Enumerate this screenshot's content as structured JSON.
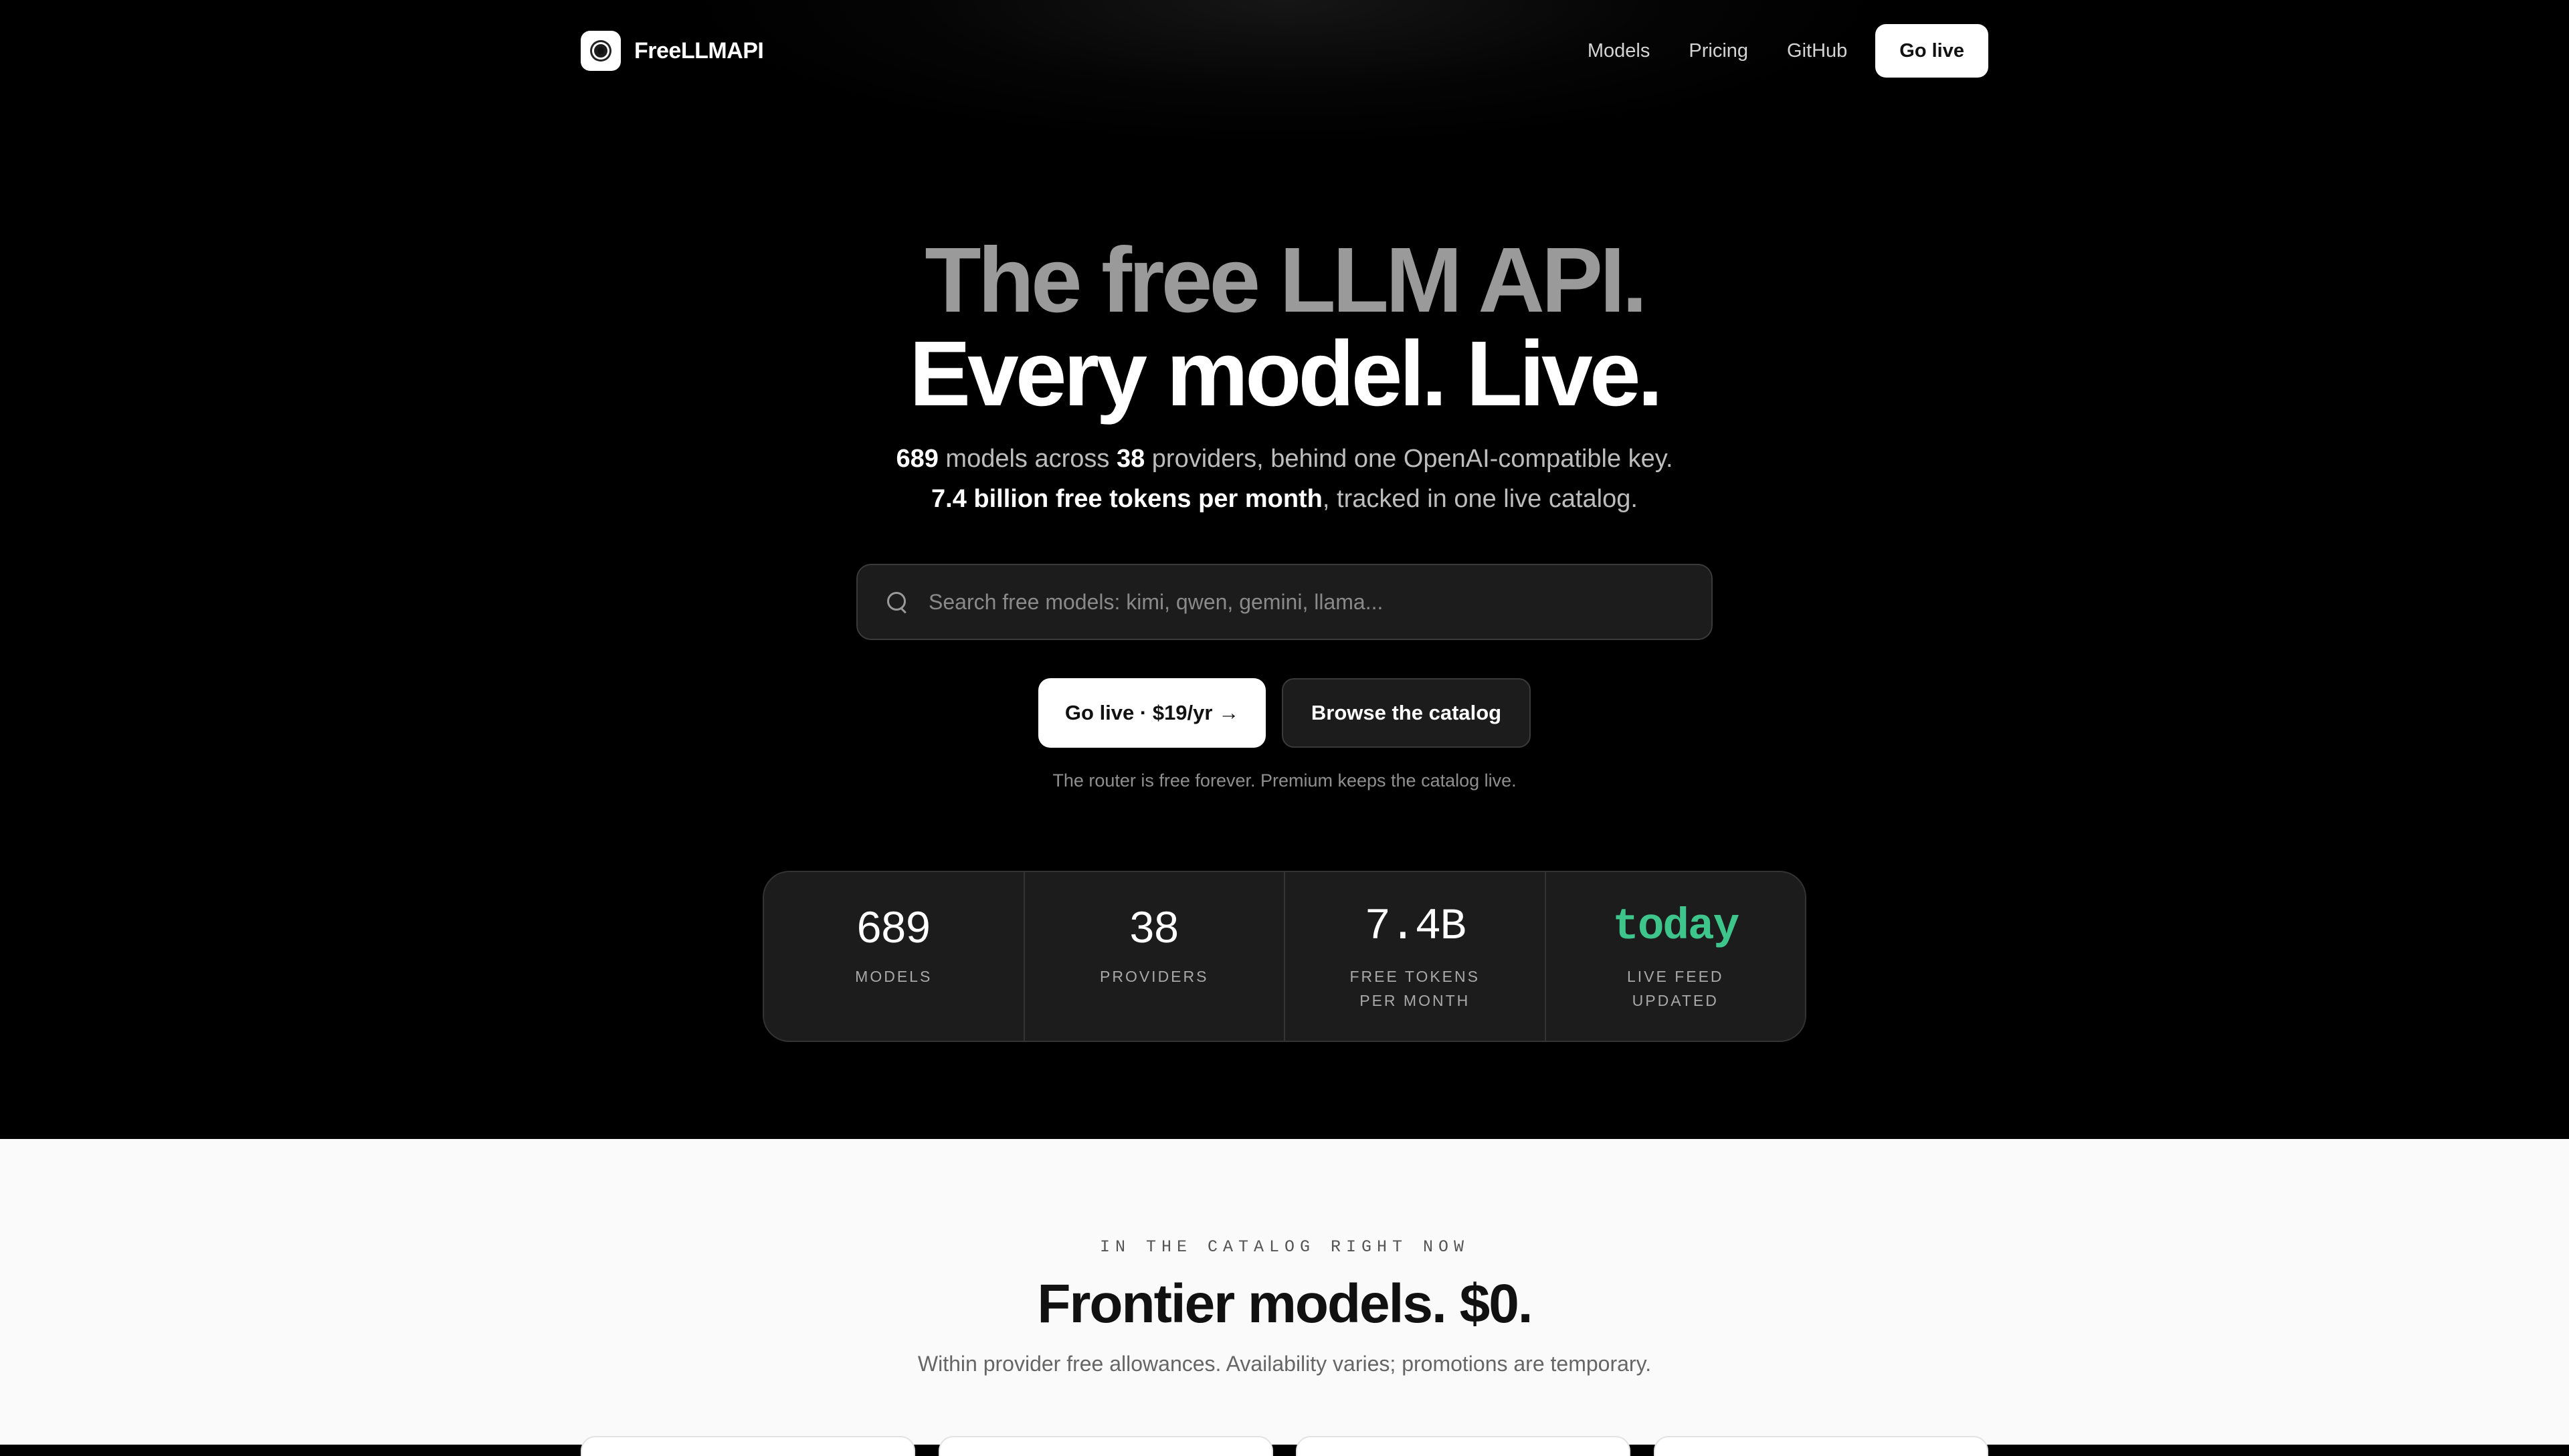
{
  "nav": {
    "brand": "FreeLLMAPI",
    "links": [
      "Models",
      "Pricing",
      "GitHub"
    ],
    "cta": "Go live"
  },
  "hero": {
    "headline_line1": "The free LLM API.",
    "headline_line2": "Every model. Live.",
    "sub1": {
      "models": "689",
      "t1": " models across ",
      "providers": "38",
      "t2": " providers, behind one OpenAI-compatible key."
    },
    "sub2": {
      "tokens": "7.4 billion free tokens per month",
      "t1": ", tracked in one live catalog."
    },
    "search_placeholder": "Search free models: kimi, qwen, gemini, llama...",
    "primary_button": "Go live · $19/yr →",
    "secondary_button": "Browse the catalog",
    "note": "The router is free forever. Premium keeps the catalog live."
  },
  "stats": [
    {
      "value": "689",
      "label": "MODELS"
    },
    {
      "value": "38",
      "label": "PROVIDERS"
    },
    {
      "value": "7.4B",
      "label": "FREE TOKENS PER MONTH"
    },
    {
      "value": "today",
      "label": "LIVE FEED UPDATED"
    }
  ],
  "colors": {
    "accent_green": "#3ec58c",
    "background": "#000000",
    "lower_background": "#fafafa"
  },
  "catalog": {
    "eyebrow": "IN THE CATALOG RIGHT NOW",
    "title": "Frontier models. $0.",
    "subtitle": "Within provider free allowances. Availability varies; promotions are temporary."
  }
}
